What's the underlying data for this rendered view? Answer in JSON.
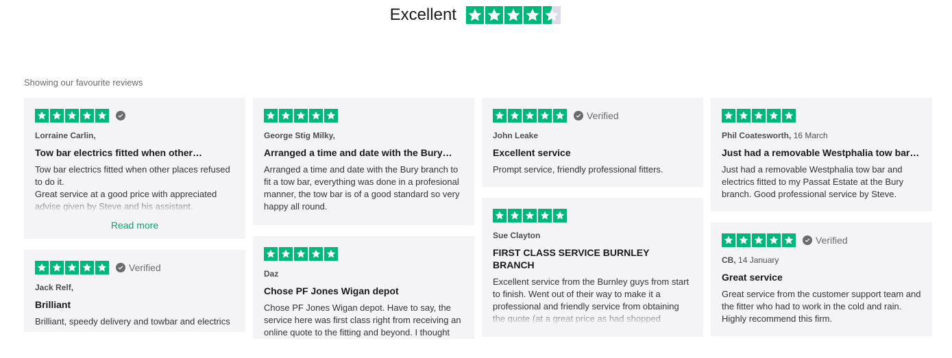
{
  "header": {
    "rating_word": "Excellent",
    "stars": 4.5
  },
  "subheading": "Showing our favourite reviews",
  "colors": {
    "star_green": "#00b67a",
    "star_empty": "#dcdce6",
    "card_bg": "#f4f4f6",
    "readmore": "#04a86b"
  },
  "reviews": [
    {
      "reviewer": "Lorraine Carlin",
      "date": "",
      "verified": "",
      "title": "Tow bar electrics fitted when other…",
      "body": "Tow bar electrics fitted when other places refused to do it.\nGreat service at a good price with appreciated advise given by Steve and his assistant.",
      "read_more": "Read more"
    },
    {
      "reviewer": "Jack Relf",
      "date": "",
      "verified": "Verified",
      "title": "Brilliant",
      "body": "Brilliant, speedy delivery and towbar and electrics"
    },
    {
      "reviewer": "George Stig Milky",
      "date": "",
      "verified": "",
      "title": "Arranged a time and date with the Bury…",
      "body": "Arranged a time and date with the Bury branch to fit a tow bar, everything was done in a profesional manner, the tow bar is of a good standard so very happy all round."
    },
    {
      "reviewer": "Daz",
      "date": "",
      "verified": "",
      "title": "Chose PF Jones Wigan depot",
      "body": "Chose PF Jones Wigan depot. Have to say, the service here was first class right from receiving an online quote to the fitting and beyond. I thought"
    },
    {
      "reviewer": "John Leake",
      "date": "",
      "verified": "Verified",
      "title": "Excellent service",
      "body": "Prompt service, friendly professional fitters."
    },
    {
      "reviewer": "Sue Clayton",
      "date": "",
      "verified": "",
      "title": "FIRST CLASS SERVICE BURNLEY BRANCH",
      "body": "Excellent service from the Burnley guys from start to finish. Went out of their way to make it a professional and friendly service from obtaining the quote (at a great price as had shopped"
    },
    {
      "reviewer": "Phil Coatesworth",
      "date": "16 March",
      "verified": "",
      "title": "Just had a removable Westphalia tow bar…",
      "body": "Just had a removable Westphalia tow bar and electrics fitted to my Passat Estate at the Bury branch. Good professional service by Steve."
    },
    {
      "reviewer": "CB",
      "date": "14 January",
      "verified": "Verified",
      "title": "Great service",
      "body": "Great service from the customer support team and the fitter who had to work in the cold and rain. Highly recommend this firm."
    }
  ]
}
